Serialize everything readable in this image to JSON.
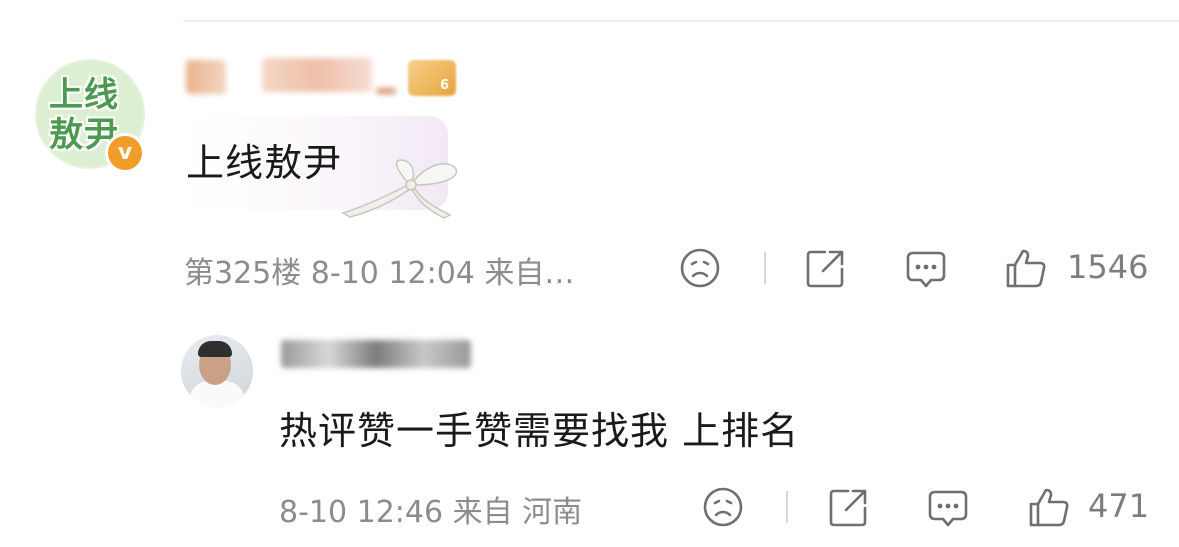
{
  "main_comment": {
    "avatar_text": "上线敖尹",
    "verified_badge": "v",
    "level_badge": "6",
    "text": "上线敖尹",
    "meta": "第325楼 8-10 12:04 来自…",
    "like_count": "1546"
  },
  "reply": {
    "text": "热评赞一手赞需要找我 上排名",
    "meta": "8-10 12:46 来自 河南",
    "like_count": "471"
  },
  "icons": {
    "dislike": "sad-face-icon",
    "share": "share-icon",
    "comment": "comment-icon",
    "like": "thumbs-up-icon"
  },
  "colors": {
    "verified": "#f19d29",
    "meta_text": "#8c8c8c",
    "avatar_green": "#4c9a4f"
  }
}
